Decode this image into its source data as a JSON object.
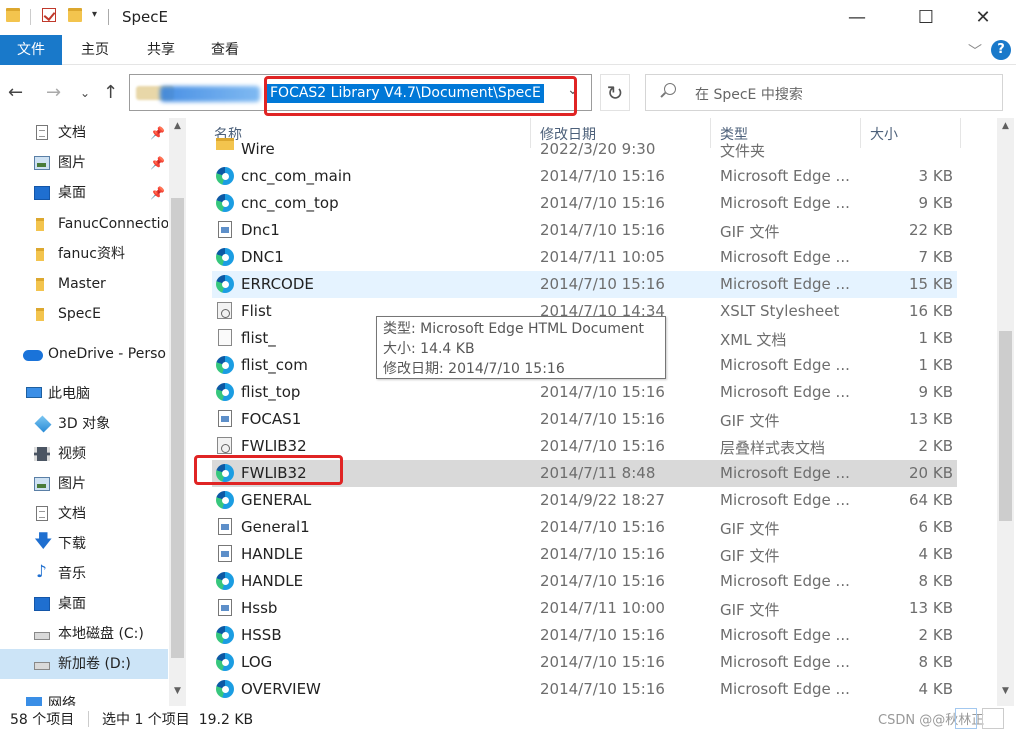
{
  "title": "SpecE",
  "ribbon": {
    "tabs": [
      {
        "label": "文件"
      },
      {
        "label": "主页"
      },
      {
        "label": "共享"
      },
      {
        "label": "查看"
      }
    ],
    "help": "?"
  },
  "address": {
    "path": "FOCAS2 Library V4.7\\Document\\SpecE"
  },
  "search": {
    "placeholder": "在 SpecE 中搜索"
  },
  "sidebar": {
    "items": [
      {
        "label": "文档",
        "icon": "document-icon",
        "pinned": true
      },
      {
        "label": "图片",
        "icon": "pictures-icon",
        "pinned": true
      },
      {
        "label": "桌面",
        "icon": "desktop-icon",
        "pinned": true
      },
      {
        "label": "FanucConnectio",
        "icon": "folder-icon"
      },
      {
        "label": "fanuc资料",
        "icon": "folder-icon"
      },
      {
        "label": "Master",
        "icon": "folder-icon"
      },
      {
        "label": "SpecE",
        "icon": "folder-icon"
      },
      {
        "label": "OneDrive - Perso",
        "icon": "onedrive-icon"
      },
      {
        "label": "此电脑",
        "icon": "pc-icon"
      },
      {
        "label": "3D 对象",
        "icon": "3d-objects-icon"
      },
      {
        "label": "视频",
        "icon": "video-icon"
      },
      {
        "label": "图片",
        "icon": "pictures-icon"
      },
      {
        "label": "文档",
        "icon": "document-icon"
      },
      {
        "label": "下载",
        "icon": "download-icon"
      },
      {
        "label": "音乐",
        "icon": "music-icon"
      },
      {
        "label": "桌面",
        "icon": "desktop-icon"
      },
      {
        "label": "本地磁盘 (C:)",
        "icon": "drive-icon"
      },
      {
        "label": "新加卷 (D:)",
        "icon": "drive-icon"
      },
      {
        "label": "网络",
        "icon": "network-icon"
      }
    ]
  },
  "columns": {
    "name": "名称",
    "date": "修改日期",
    "type": "类型",
    "size": "大小"
  },
  "files": [
    {
      "name": "Wire",
      "date": "2022/3/20 9:30",
      "type": "文件夹",
      "size": "",
      "icon": "folder"
    },
    {
      "name": "cnc_com_main",
      "date": "2014/7/10 15:16",
      "type": "Microsoft Edge ...",
      "size": "3 KB",
      "icon": "edge"
    },
    {
      "name": "cnc_com_top",
      "date": "2014/7/10 15:16",
      "type": "Microsoft Edge ...",
      "size": "9 KB",
      "icon": "edge"
    },
    {
      "name": "Dnc1",
      "date": "2014/7/10 15:16",
      "type": "GIF 文件",
      "size": "22 KB",
      "icon": "gif"
    },
    {
      "name": "DNC1",
      "date": "2014/7/11 10:05",
      "type": "Microsoft Edge ...",
      "size": "7 KB",
      "icon": "edge"
    },
    {
      "name": "ERRCODE",
      "date": "2014/7/10 15:16",
      "type": "Microsoft Edge ...",
      "size": "15 KB",
      "icon": "edge"
    },
    {
      "name": "Flist",
      "date": "2014/7/10 14:34",
      "type": "XSLT Stylesheet",
      "size": "16 KB",
      "icon": "xslt"
    },
    {
      "name": "flist_",
      "date": "",
      "type": "XML 文档",
      "size": "1 KB",
      "icon": "xml"
    },
    {
      "name": "flist_com",
      "date": "",
      "type": "Microsoft Edge ...",
      "size": "1 KB",
      "icon": "edge"
    },
    {
      "name": "flist_top",
      "date": "2014/7/10 15:16",
      "type": "Microsoft Edge ...",
      "size": "9 KB",
      "icon": "edge"
    },
    {
      "name": "FOCAS1",
      "date": "2014/7/10 15:16",
      "type": "GIF 文件",
      "size": "13 KB",
      "icon": "gif"
    },
    {
      "name": "FWLIB32",
      "date": "2014/7/10 15:16",
      "type": "层叠样式表文档",
      "size": "2 KB",
      "icon": "xslt"
    },
    {
      "name": "FWLIB32",
      "date": "2014/7/11 8:48",
      "type": "Microsoft Edge ...",
      "size": "20 KB",
      "icon": "edge"
    },
    {
      "name": "GENERAL",
      "date": "2014/9/22 18:27",
      "type": "Microsoft Edge ...",
      "size": "64 KB",
      "icon": "edge"
    },
    {
      "name": "General1",
      "date": "2014/7/10 15:16",
      "type": "GIF 文件",
      "size": "6 KB",
      "icon": "gif"
    },
    {
      "name": "HANDLE",
      "date": "2014/7/10 15:16",
      "type": "GIF 文件",
      "size": "4 KB",
      "icon": "gif"
    },
    {
      "name": "HANDLE",
      "date": "2014/7/10 15:16",
      "type": "Microsoft Edge ...",
      "size": "8 KB",
      "icon": "edge"
    },
    {
      "name": "Hssb",
      "date": "2014/7/11 10:00",
      "type": "GIF 文件",
      "size": "13 KB",
      "icon": "gif"
    },
    {
      "name": "HSSB",
      "date": "2014/7/10 15:16",
      "type": "Microsoft Edge ...",
      "size": "2 KB",
      "icon": "edge"
    },
    {
      "name": "LOG",
      "date": "2014/7/10 15:16",
      "type": "Microsoft Edge ...",
      "size": "8 KB",
      "icon": "edge"
    },
    {
      "name": "OVERVIEW",
      "date": "2014/7/10 15:16",
      "type": "Microsoft Edge ...",
      "size": "4 KB",
      "icon": "edge"
    }
  ],
  "tooltip": {
    "type": "类型: Microsoft Edge HTML Document",
    "size": "大小: 14.4 KB",
    "date": "修改日期: 2014/7/10 15:16"
  },
  "status": {
    "count": "58 个项目",
    "selection": "选中 1 个项目  19.2 KB",
    "watermark": "CSDN @@秋林正"
  },
  "colors": {
    "accent": "#1979ca",
    "highlight": "#e02424",
    "selection": "#d9d9d9",
    "hover": "#e5f3ff"
  }
}
